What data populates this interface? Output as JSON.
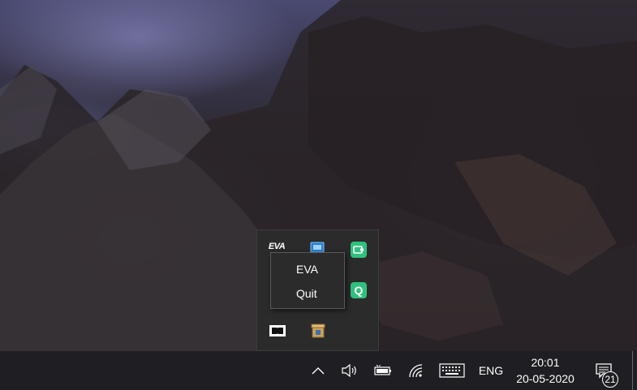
{
  "tray_flyout": {
    "icons": [
      "eva-logo",
      "display-app-icon",
      "green-app-icon",
      "green-q-icon",
      "dolby-icon",
      "package-icon"
    ],
    "eva_logo_text": "EVA",
    "q_label": "Q"
  },
  "context_menu": {
    "items": [
      {
        "label": "EVA"
      },
      {
        "label": "Quit"
      }
    ]
  },
  "taskbar": {
    "language": "ENG",
    "time": "20:01",
    "date": "20-05-2020",
    "notification_count": "21",
    "icons": [
      "chevron-up-icon",
      "speaker-icon",
      "battery-icon",
      "wifi-icon",
      "keyboard-icon",
      "notification-icon"
    ]
  }
}
